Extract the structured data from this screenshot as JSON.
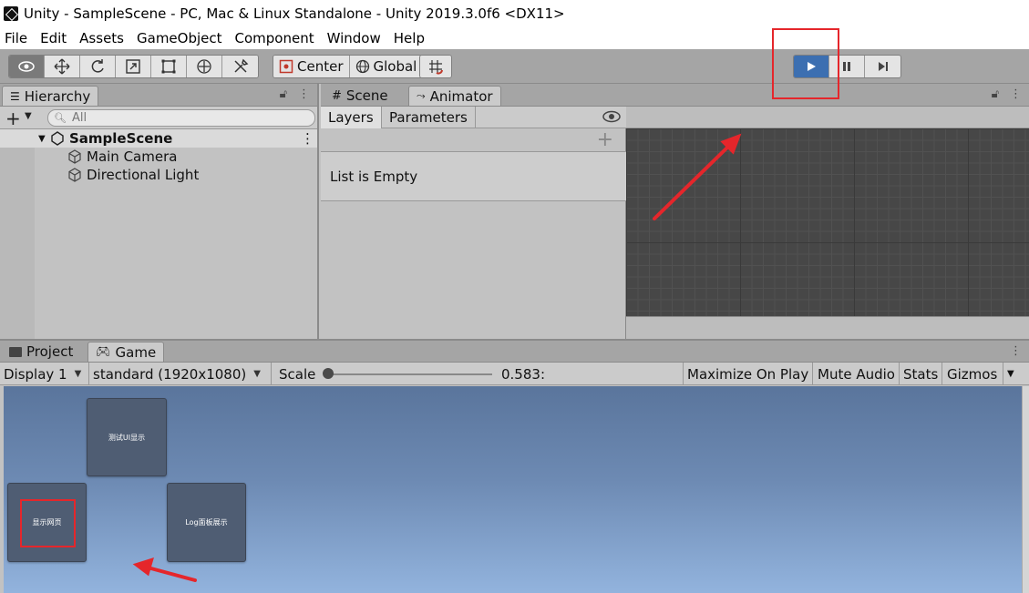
{
  "window": {
    "title": "Unity - SampleScene - PC, Mac & Linux Standalone - Unity 2019.3.0f6 <DX11>"
  },
  "menu": [
    "File",
    "Edit",
    "Assets",
    "GameObject",
    "Component",
    "Window",
    "Help"
  ],
  "toolbar": {
    "tools": [
      "view-tool",
      "move-tool",
      "rotate-tool",
      "scale-tool",
      "rect-tool",
      "transform-tool",
      "custom-tool"
    ],
    "pivot_mode": "Center",
    "pivot_rotation": "Global",
    "snap": "grid-snap-icon"
  },
  "play_controls": {
    "play": "play-icon",
    "pause": "pause-icon",
    "step": "step-icon",
    "active_color": "#3c6fb1"
  },
  "hierarchy": {
    "tab": "Hierarchy",
    "search_placeholder": "All",
    "scene": "SampleScene",
    "items": [
      "Main Camera",
      "Directional Light"
    ]
  },
  "scene_tab": "Scene",
  "animator": {
    "tab": "Animator",
    "subtabs": [
      "Layers",
      "Parameters"
    ],
    "empty_text": "List is Empty"
  },
  "bottom_tabs": {
    "project": "Project",
    "game": "Game"
  },
  "game_toolbar": {
    "display": "Display 1",
    "resolution": "standard (1920x1080)",
    "scale_label": "Scale",
    "scale_value": "0.583:",
    "maximize": "Maximize On Play",
    "mute": "Mute Audio",
    "stats": "Stats",
    "gizmos": "Gizmos"
  },
  "game_buttons": [
    "测试UI显示",
    "显示网页",
    "Log面板展示"
  ],
  "colors": {
    "annotation": "#e5262b",
    "game_button": "#4f5d73"
  }
}
